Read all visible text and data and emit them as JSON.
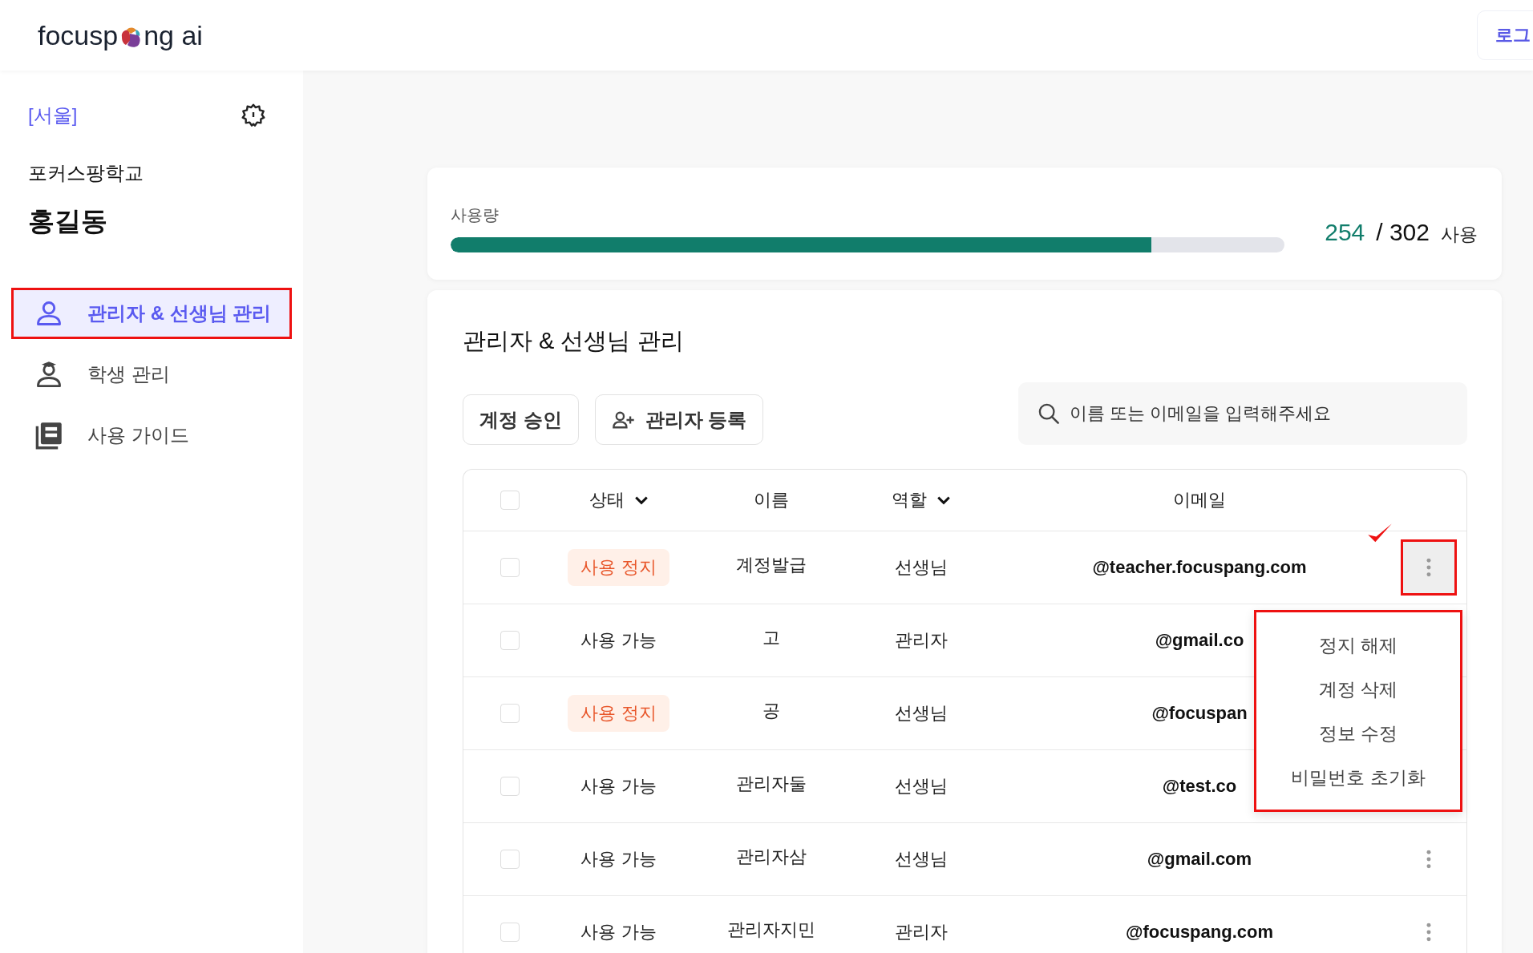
{
  "header": {
    "logo_before": "focusp",
    "logo_after": "ng ai",
    "login_button": "로그"
  },
  "sidebar": {
    "region": "[서울]",
    "school": "포커스팡학교",
    "user": "홍길동",
    "items": [
      {
        "label": "관리자 & 선생님 관리",
        "kind": "person",
        "selected": true,
        "highlighted": true
      },
      {
        "label": "학생 관리",
        "kind": "student",
        "selected": false,
        "highlighted": false
      },
      {
        "label": "사용 가이드",
        "kind": "guide",
        "selected": false,
        "highlighted": false
      }
    ]
  },
  "usage": {
    "label": "사용량",
    "level": 0.84,
    "used": "254",
    "total": "/ 302",
    "unit": "사용"
  },
  "panel": {
    "title": "관리자 & 선생님 관리",
    "buttons": [
      {
        "label": "계정 승인",
        "kind": "plain"
      },
      {
        "label": "관리자 등록",
        "kind": "add-person"
      }
    ],
    "search": {
      "placeholder": "이름 또는 이메일을 입력해주세요"
    }
  },
  "table": {
    "select_all": {
      "checked": false
    },
    "columns": [
      {
        "label": "상태",
        "filter": true
      },
      {
        "label": "이름",
        "filter": false
      },
      {
        "label": "역할",
        "filter": true
      },
      {
        "label": "이메일",
        "filter": false
      }
    ],
    "rows": [
      {
        "selected": false,
        "status": "사용 정지",
        "kind": "suspended",
        "name": "계정발급",
        "role": "선생님",
        "email": "@teacher.focuspang.com",
        "menu_button": true,
        "highlighted": true
      },
      {
        "selected": false,
        "status": "사용 가능",
        "kind": "active",
        "name": "고",
        "role": "관리자",
        "email": "@gmail.co",
        "menu_button": false
      },
      {
        "selected": false,
        "status": "사용 정지",
        "kind": "suspended",
        "name": "공",
        "role": "선생님",
        "email": "@focuspan",
        "menu_button": false
      },
      {
        "selected": false,
        "status": "사용 가능",
        "kind": "active",
        "name": "관리자둘",
        "role": "선생님",
        "email": "@test.co",
        "menu_button": false
      },
      {
        "selected": false,
        "status": "사용 가능",
        "kind": "active",
        "name": "관리자삼",
        "role": "선생님",
        "email": "@gmail.com",
        "menu_button": true,
        "highlighted": false
      },
      {
        "selected": false,
        "status": "사용 가능",
        "kind": "active",
        "name": "관리자지민",
        "role": "관리자",
        "email": "@focuspang.com",
        "menu_button": true,
        "highlighted": false
      }
    ]
  },
  "context_menu": {
    "highlighted": true,
    "items": [
      "정지 해제",
      "계정 삭제",
      "정보 수정",
      "비밀번호 초기화"
    ]
  }
}
